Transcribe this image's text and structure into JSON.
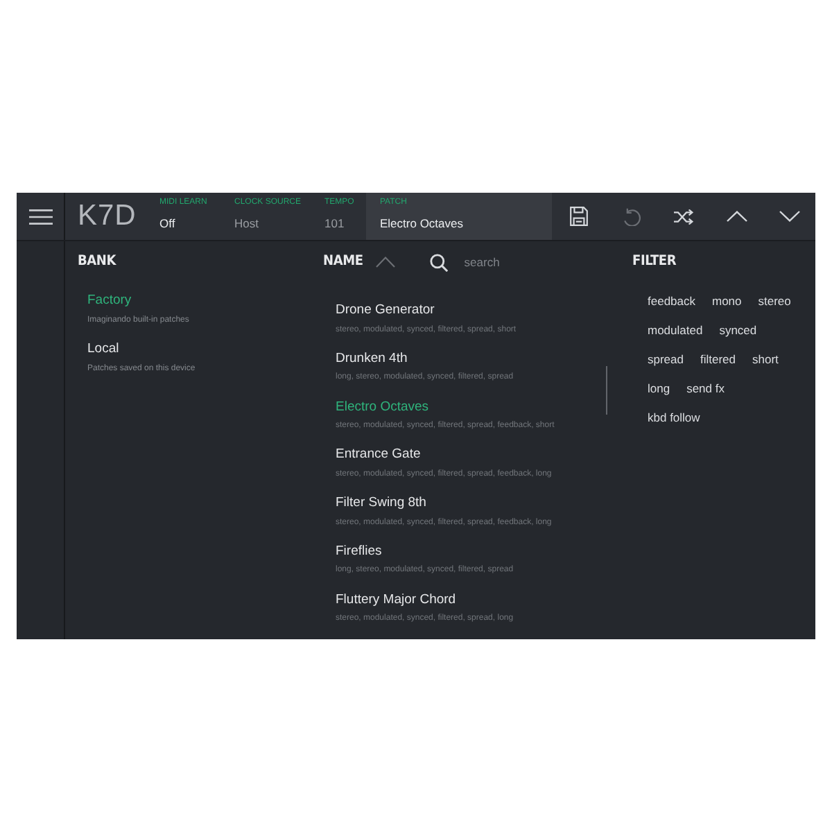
{
  "header": {
    "logo": "K7D",
    "fields": [
      {
        "kind": "setting",
        "label": "MIDI LEARN",
        "value": "Off",
        "disabled": false
      },
      {
        "kind": "setting",
        "label": "CLOCK SOURCE",
        "value": "Host",
        "disabled": true
      },
      {
        "kind": "setting",
        "label": "TEMPO",
        "value": "101",
        "disabled": true
      },
      {
        "kind": "patch",
        "label": "PATCH",
        "value": "Electro Octaves",
        "disabled": false
      }
    ],
    "toolbar": [
      {
        "kind": "save",
        "disabled": false
      },
      {
        "kind": "undo",
        "disabled": true
      },
      {
        "kind": "shuffle",
        "disabled": false
      },
      {
        "kind": "previous",
        "disabled": false
      },
      {
        "kind": "next",
        "disabled": false
      }
    ]
  },
  "bank": {
    "heading": "BANK",
    "items": [
      {
        "name": "Factory",
        "description": "Imaginando built-in patches",
        "selected": true
      },
      {
        "name": "Local",
        "description": "Patches saved on this device",
        "selected": false
      }
    ]
  },
  "patches": {
    "heading": "NAME",
    "search": {
      "placeholder": "search"
    },
    "items": [
      {
        "name": "Drone Generator",
        "tags": "stereo, modulated, synced, filtered, spread, short",
        "selected": false
      },
      {
        "name": "Drunken 4th",
        "tags": "long, stereo, modulated, synced, filtered, spread",
        "selected": false
      },
      {
        "name": "Electro Octaves",
        "tags": "stereo, modulated, synced, filtered, spread, feedback, short",
        "selected": true
      },
      {
        "name": "Entrance Gate",
        "tags": "stereo, modulated, synced, filtered, spread, feedback, long",
        "selected": false
      },
      {
        "name": "Filter Swing 8th",
        "tags": "stereo, modulated, synced, filtered, spread, feedback, long",
        "selected": false
      },
      {
        "name": "Fireflies",
        "tags": "long, stereo, modulated, synced, filtered, spread",
        "selected": false
      },
      {
        "name": "Fluttery Major Chord",
        "tags": "stereo, modulated, synced, filtered, spread, long",
        "selected": false
      }
    ]
  },
  "filter": {
    "heading": "FILTER",
    "tags": [
      {
        "label": "feedback",
        "selected": false
      },
      {
        "label": "mono",
        "selected": false
      },
      {
        "label": "stereo",
        "selected": false
      },
      {
        "label": "modulated",
        "selected": false
      },
      {
        "label": "synced",
        "selected": false
      },
      {
        "label": "spread",
        "selected": false
      },
      {
        "label": "filtered",
        "selected": false
      },
      {
        "label": "short",
        "selected": false
      },
      {
        "label": "long",
        "selected": false
      },
      {
        "label": "send fx",
        "selected": false
      },
      {
        "label": "kbd follow",
        "selected": false
      }
    ]
  }
}
